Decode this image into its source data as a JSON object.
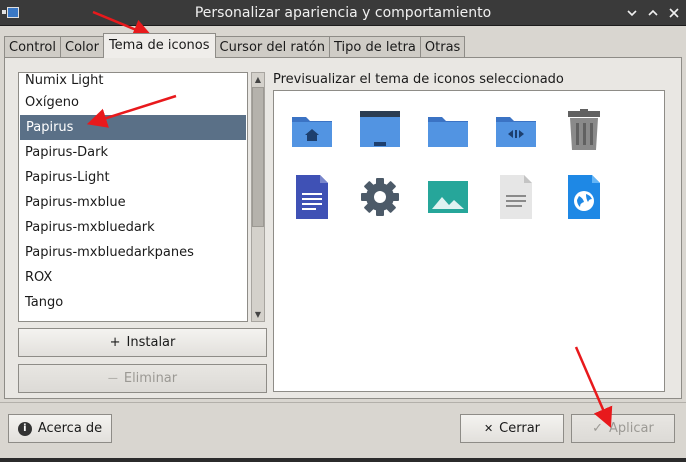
{
  "window": {
    "title": "Personalizar apariencia y comportamiento"
  },
  "tabs": [
    {
      "label": "Control",
      "active": false
    },
    {
      "label": "Color",
      "active": false
    },
    {
      "label": "Tema de iconos",
      "active": true
    },
    {
      "label": "Cursor del ratón",
      "active": false
    },
    {
      "label": "Tipo de letra",
      "active": false
    },
    {
      "label": "Otras",
      "active": false
    }
  ],
  "theme_list": {
    "items": [
      "Numix Light",
      "Oxígeno",
      "Papirus",
      "Papirus-Dark",
      "Papirus-Light",
      "Papirus-mxblue",
      "Papirus-mxbluedark",
      "Papirus-mxbluedarkpanes",
      "ROX",
      "Tango"
    ],
    "selected": "Papirus"
  },
  "buttons": {
    "install": "Instalar",
    "install_icon": "+",
    "remove": "Eliminar",
    "remove_icon": "—",
    "about": "Acerca de",
    "about_icon": "i",
    "close": "Cerrar",
    "close_icon": "✕",
    "apply": "Aplicar",
    "apply_icon": "✓"
  },
  "preview": {
    "label": "Previsualizar el tema de iconos seleccionado",
    "icons": [
      "folder-home-icon",
      "desktop-folder-icon",
      "folder-icon",
      "folder-remote-icon",
      "trash-icon",
      "document-icon",
      "settings-gear-icon",
      "image-viewer-icon",
      "text-file-icon",
      "web-browser-icon"
    ]
  },
  "colors": {
    "selection": "#5a7087",
    "folder_blue": "#5294e2",
    "folder_dark_blue": "#3b73c4",
    "annotation_arrow": "#e8191c"
  }
}
